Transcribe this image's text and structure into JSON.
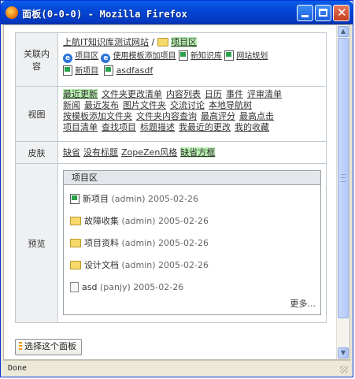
{
  "window": {
    "title": "面板(0-0-0) - Mozilla Firefox"
  },
  "rows": {
    "related": {
      "label": "关联内容",
      "breadcrumb_root": "上航IT知识库测试网站",
      "breadcrumb_sep": "/",
      "breadcrumb_current": "项目区",
      "items": [
        {
          "label": "项目区",
          "icon": "ie-icon"
        },
        {
          "label": "使用模板添加项目",
          "icon": "ie-icon"
        },
        {
          "label": "新知识库",
          "icon": "doc-icon"
        },
        {
          "label": "网站规划",
          "icon": "doc-icon"
        },
        {
          "label": "新项目",
          "icon": "doc-icon"
        },
        {
          "label": "asdfasdf",
          "icon": "doc-icon"
        }
      ]
    },
    "views": {
      "label": "视图",
      "items": [
        "最近更新",
        "文件夹更改清单",
        "内容列表",
        "日历",
        "事件",
        "评审清单",
        "新闻",
        "最近发布",
        "图片文件夹",
        "交流讨论",
        "本地导航树",
        "按模板添加文件夹",
        "文件夹内容查询",
        "最高评分",
        "最高点击",
        "项目清单",
        "查找项目",
        "标题描述",
        "我最近的更改",
        "我的收藏"
      ],
      "selected": "最近更新"
    },
    "skin": {
      "label": "皮肤",
      "items": [
        "缺省",
        "没有标题",
        "ZopeZen风格",
        "缺省方框"
      ],
      "selected": "缺省方框"
    },
    "preview": {
      "label": "预览",
      "box_title": "项目区",
      "entries": [
        {
          "title": "新项目",
          "meta": "(admin) 2005-02-26",
          "icon": "doc-icon"
        },
        {
          "title": "故障收集",
          "meta": "(admin) 2005-02-26",
          "icon": "folder-icon"
        },
        {
          "title": "项目资料",
          "meta": "(admin) 2005-02-26",
          "icon": "folder-icon"
        },
        {
          "title": "设计文档",
          "meta": "(admin) 2005-02-26",
          "icon": "folder-icon"
        },
        {
          "title": "asd",
          "meta": "(panjy) 2005-02-26",
          "icon": "file-icon"
        }
      ],
      "more": "更多..."
    }
  },
  "select_button": "选择这个面板",
  "status": "Done",
  "colors": {
    "highlight": "#b8f0b0",
    "titlebar": "#0447d6"
  }
}
